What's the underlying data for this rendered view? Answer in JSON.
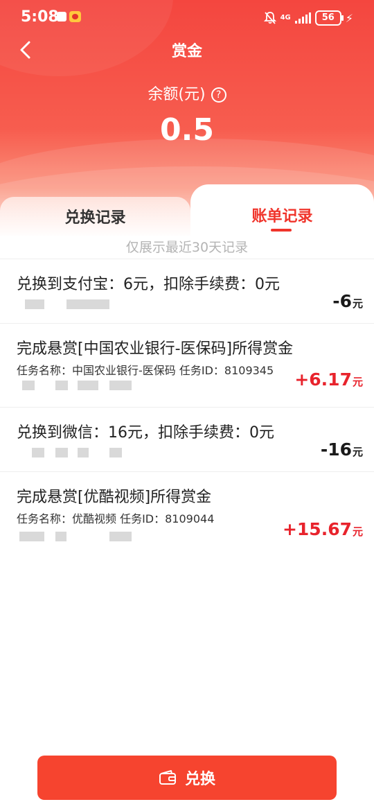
{
  "status_bar": {
    "time": "5:08",
    "network": "4G",
    "battery": "56"
  },
  "header": {
    "title": "赏金",
    "balance_label": "余额(元)",
    "balance_value": "0.5"
  },
  "tabs": [
    {
      "label": "兑换记录",
      "active": false
    },
    {
      "label": "账单记录",
      "active": true
    }
  ],
  "hint": "仅展示最近30天记录",
  "records": [
    {
      "title": "兑换到支付宝：6元，扣除手续费：0元",
      "subtitle": "",
      "amount": "-6",
      "unit": "元"
    },
    {
      "title": "完成悬赏[中国农业银行-医保码]所得赏金",
      "subtitle": "任务名称：中国农业银行-医保码    任务ID：8109345",
      "amount": "+6.17",
      "unit": "元"
    },
    {
      "title": "兑换到微信：16元，扣除手续费：0元",
      "subtitle": "",
      "amount": "-16",
      "unit": "元"
    },
    {
      "title": "完成悬赏[优酷视频]所得赏金",
      "subtitle": "任务名称：优酷视频    任务ID：8109044",
      "amount": "+15.67",
      "unit": "元"
    }
  ],
  "footer": {
    "exchange_label": "兑换"
  },
  "colors": {
    "accent": "#f0342b",
    "positive": "#e8232c",
    "button": "#f6442f"
  }
}
